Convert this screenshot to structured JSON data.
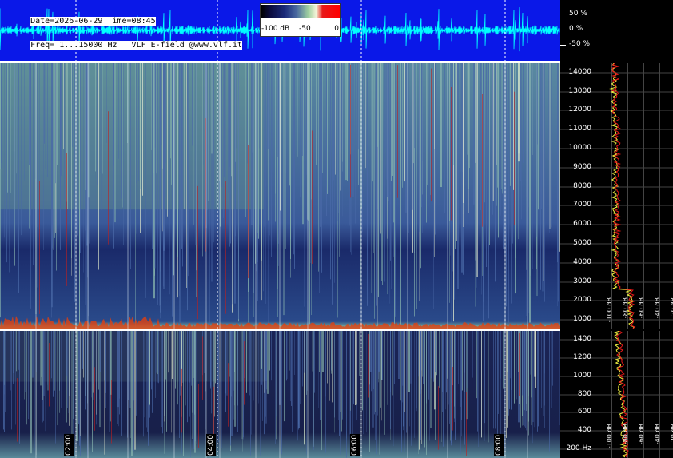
{
  "header": {
    "line1": "Date=2026-06-29 Time=08:45",
    "line2": "Freq= 1...15000 Hz   VLF E-field @www.vlf.it"
  },
  "colorbar": {
    "min_label": "-100 dB",
    "mid_label": "-50",
    "max_label": "0"
  },
  "waveform": {
    "scale": [
      "50 %",
      "0 %",
      "-50 %"
    ]
  },
  "upper_spectrogram": {
    "freq_labels": [
      "14000",
      "13000",
      "12000",
      "11000",
      "10000",
      "9000",
      "8000",
      "7000",
      "6000",
      "5000",
      "4000",
      "3000",
      "2000",
      "1000"
    ],
    "db_labels": [
      "-100 dB",
      "-80 dB",
      "-60 dB",
      "-40 dB",
      "-20 dB"
    ]
  },
  "lower_spectrogram": {
    "freq_labels": [
      "1400",
      "1200",
      "1000",
      "800",
      "600",
      "400",
      "200 Hz"
    ],
    "db_labels": [
      "-100 dB",
      "-80 dB",
      "-60 dB",
      "-40 dB",
      "-20 dB"
    ]
  },
  "time_labels": [
    "02:00",
    "04:00",
    "06:00",
    "08:00"
  ],
  "colors": {
    "waveform_bg": "#0a18e8",
    "trace": "#00ffff",
    "spec_dark": "#101a4a",
    "spec_bright": "#9fd0a0",
    "spectrum_red": "#e81818",
    "spectrum_yellow": "#f0f040"
  }
}
